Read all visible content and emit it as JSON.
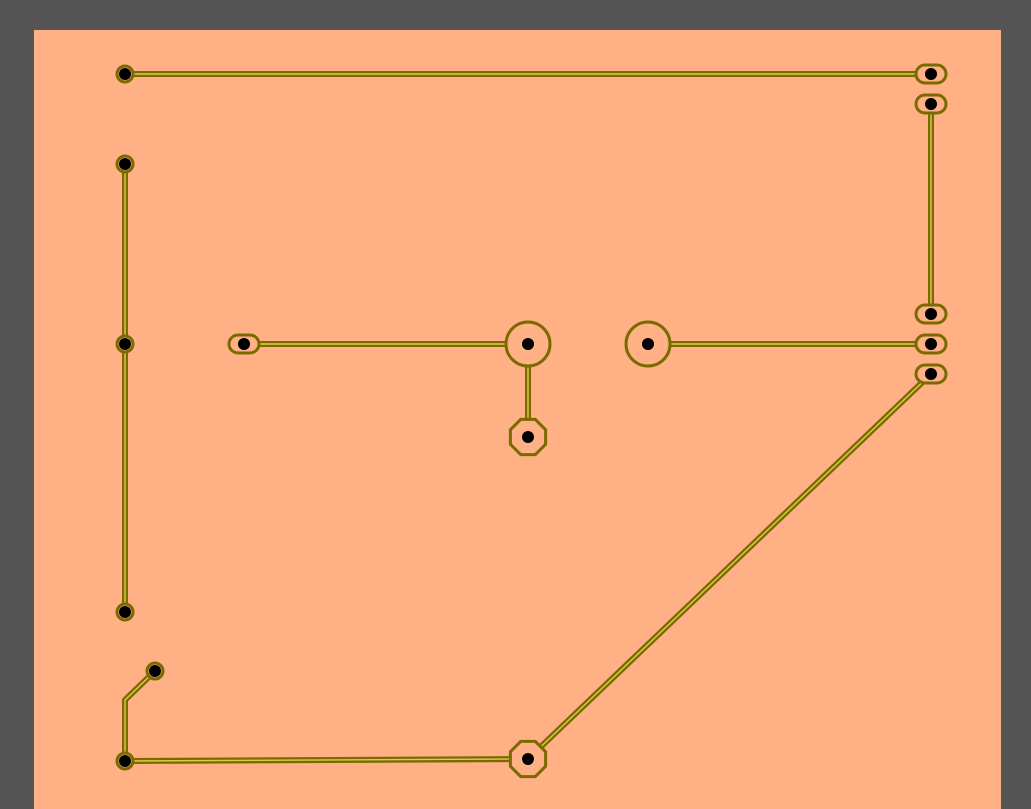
{
  "colors": {
    "frame": "#555555",
    "board": "#ffb084",
    "trace": "#7a6a00",
    "trace_highlight": "#ffee66",
    "drill": "#000000"
  },
  "pads": [
    {
      "id": "p1",
      "shape": "round"
    },
    {
      "id": "p2",
      "shape": "oblong"
    },
    {
      "id": "p3",
      "shape": "oblong"
    },
    {
      "id": "p4",
      "shape": "round"
    },
    {
      "id": "p5",
      "shape": "oblong"
    },
    {
      "id": "p6",
      "shape": "round"
    },
    {
      "id": "p7",
      "shape": "oblong"
    },
    {
      "id": "p8",
      "shape": "large-round"
    },
    {
      "id": "p9",
      "shape": "octagon"
    },
    {
      "id": "p10",
      "shape": "large-round"
    },
    {
      "id": "p11",
      "shape": "oblong"
    },
    {
      "id": "p12",
      "shape": "oblong"
    },
    {
      "id": "p13",
      "shape": "round"
    },
    {
      "id": "p14",
      "shape": "round"
    },
    {
      "id": "p15",
      "shape": "round"
    },
    {
      "id": "p16",
      "shape": "octagon"
    }
  ],
  "traces": [
    {
      "from": "p1",
      "to": "p2"
    },
    {
      "from": "p3",
      "to": "p5"
    },
    {
      "from": "p4",
      "to": "p6"
    },
    {
      "from": "p7",
      "to": "p8"
    },
    {
      "from": "p8",
      "to": "p9"
    },
    {
      "from": "p10",
      "to": "p11"
    },
    {
      "from": "p12",
      "to": "p16"
    },
    {
      "from": "p14",
      "to": "p15"
    },
    {
      "from": "p15",
      "to": "p16"
    }
  ]
}
